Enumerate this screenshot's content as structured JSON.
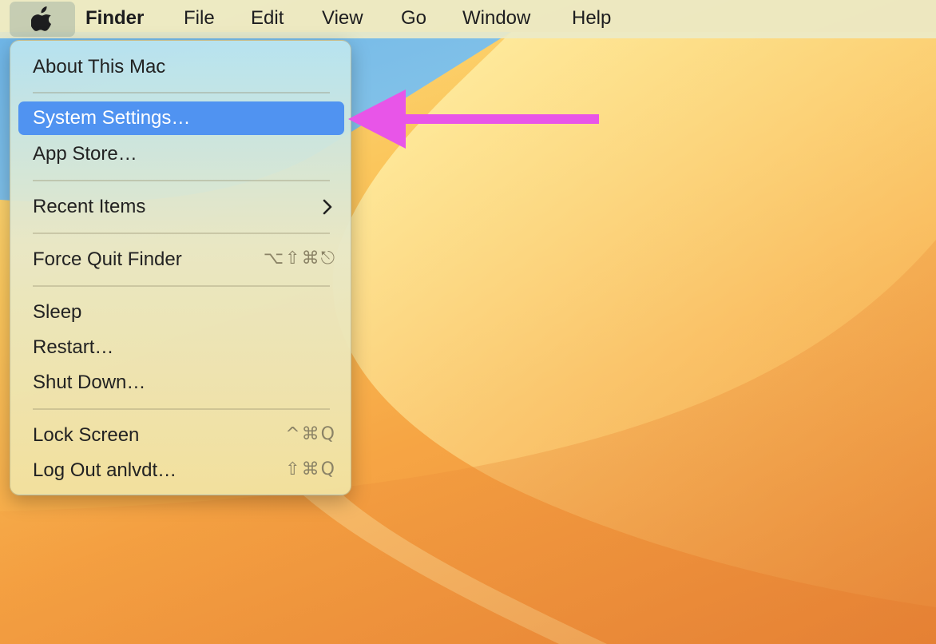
{
  "menubar": {
    "apple_icon": "apple-logo-icon",
    "app_name": "Finder",
    "menus": [
      "File",
      "Edit",
      "View",
      "Go",
      "Window",
      "Help"
    ]
  },
  "apple_menu": {
    "about": "About This Mac",
    "system_settings": "System Settings…",
    "app_store": "App Store…",
    "recent_items": "Recent Items",
    "force_quit": "Force Quit Finder",
    "force_quit_shortcut": "⌥⇧⌘⎋",
    "sleep": "Sleep",
    "restart": "Restart…",
    "shut_down": "Shut Down…",
    "lock_screen": "Lock Screen",
    "lock_screen_shortcut": "^⌘Q",
    "log_out": "Log Out anlvdt…",
    "log_out_shortcut": "⇧⌘Q"
  },
  "annotation": {
    "arrow_color": "#e855e8"
  },
  "colors": {
    "highlight": "#5093f1"
  }
}
